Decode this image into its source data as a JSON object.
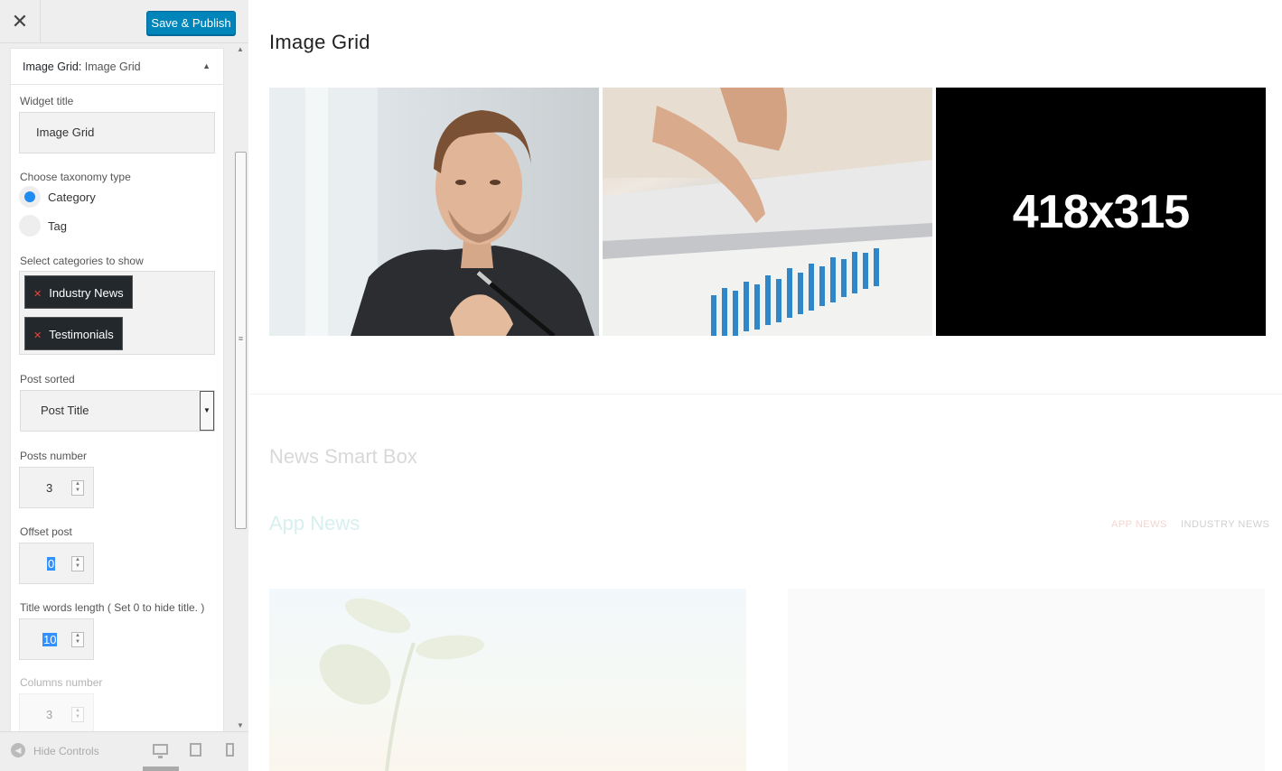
{
  "topbar": {
    "close_glyph": "✕",
    "publish_label": "Save & Publish"
  },
  "widget": {
    "type_label": "Image Grid:",
    "name_label": " Image Grid",
    "fields": {
      "title_label": "Widget title",
      "title_value": "Image Grid",
      "taxonomy_label": "Choose taxonomy type",
      "taxonomy_options": [
        "Category",
        "Tag"
      ],
      "taxonomy_selected": "Category",
      "categories_label": "Select categories to show",
      "categories": [
        "Industry News",
        "Testimonials"
      ],
      "sort_label": "Post sorted",
      "sort_value": "Post Title",
      "posts_number_label": "Posts number",
      "posts_number_value": "3",
      "offset_label": "Offset post",
      "offset_value": "0",
      "title_words_label": "Title words length ( Set 0 to hide title. )",
      "title_words_value": "10",
      "columns_label": "Columns number",
      "columns_value": "3"
    }
  },
  "bottom_bar": {
    "hide_label": "Hide Controls",
    "devices": [
      "desktop-icon",
      "tablet-icon",
      "mobile-icon"
    ]
  },
  "preview": {
    "grid_title": "Image Grid",
    "tile3_placeholder": "418x315",
    "smart_box_title": "News Smart Box",
    "app_news_title": "App News",
    "tabs": [
      "APP NEWS",
      "INDUSTRY NEWS"
    ]
  },
  "colors": {
    "accent": "#0085ba",
    "radio_checked": "#1e8cf0",
    "chip_bg": "#23282d",
    "chip_remove": "#e3473b"
  }
}
